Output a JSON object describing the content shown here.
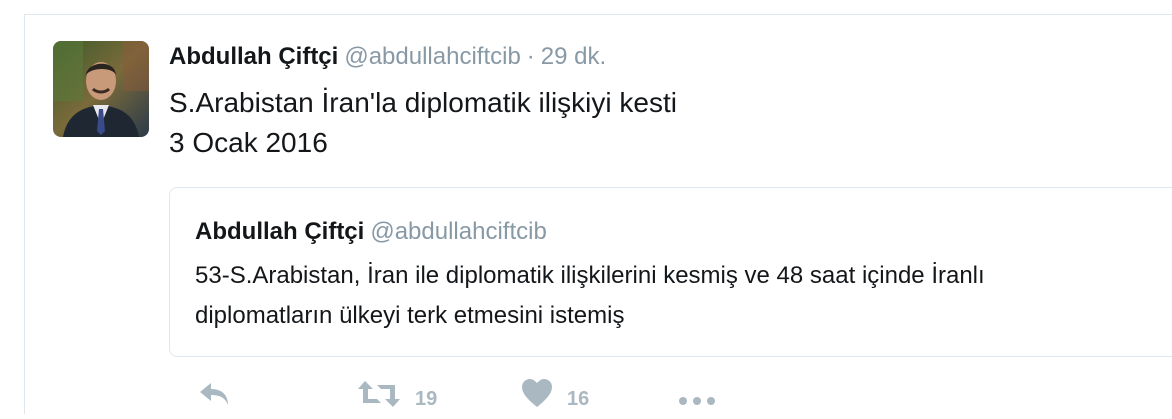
{
  "tweet": {
    "author": {
      "fullname": "Abdullah Çiftçi",
      "username": "@abdullahciftcib"
    },
    "separator": "·",
    "time": "29 dk.",
    "text_lines": [
      "S.Arabistan İran'la diplomatik ilişkiyi kesti",
      "3 Ocak 2016"
    ],
    "quoted": {
      "fullname": "Abdullah Çiftçi",
      "username": "@abdullahciftcib",
      "text_lines": [
        "53-S.Arabistan, İran ile diplomatik ilişkilerini kesmiş ve 48 saat içinde İranlı",
        "diplomatların ülkeyi terk etmesini istemiş"
      ]
    },
    "actions": {
      "retweet_count": "19",
      "like_count": "16"
    }
  },
  "colors": {
    "text": "#14171a",
    "secondary": "#8899a6",
    "icon": "#aab8c2",
    "border": "#e1e8ed"
  },
  "icons": [
    "reply-icon",
    "retweet-icon",
    "heart-icon",
    "more-icon"
  ]
}
